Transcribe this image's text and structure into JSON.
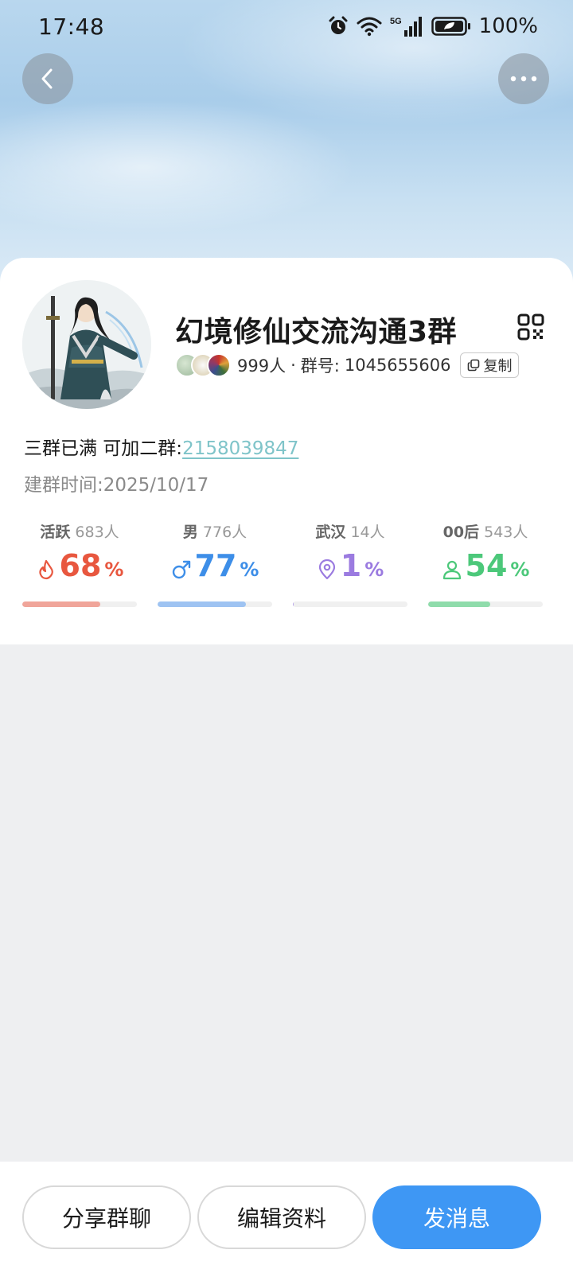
{
  "status_bar": {
    "time": "17:48",
    "network": "5G",
    "battery": "100%"
  },
  "header": {
    "back_icon": "chevron-left-icon",
    "more_icon": "more-horizontal-icon"
  },
  "group": {
    "name": "幻境修仙交流沟通3群",
    "member_count": "999人",
    "separator": "·",
    "id_label": "群号:",
    "id_value": "1045655606",
    "copy_label": "复制",
    "description_prefix": "三群已满 可加二群:",
    "description_link": "2158039847",
    "created_label": "建群时间:",
    "created_date": "2025/10/17"
  },
  "stats": [
    {
      "label": "活跃",
      "count": "683人",
      "value": "68",
      "unit": "%",
      "fraction": 0.68,
      "icon": "flame-icon",
      "color": "#e8573f",
      "bar_color": "#f0a59a"
    },
    {
      "label": "男",
      "count": "776人",
      "value": "77",
      "unit": "%",
      "fraction": 0.77,
      "icon": "male-icon",
      "color": "#3d8ee8",
      "bar_color": "#9ec3f2"
    },
    {
      "label": "武汉",
      "count": "14人",
      "value": "1",
      "unit": "%",
      "fraction": 0.01,
      "icon": "location-pin-icon",
      "color": "#9b7be0",
      "bar_color": "#b9a6ea"
    },
    {
      "label": "00后",
      "count": "543人",
      "value": "54",
      "unit": "%",
      "fraction": 0.54,
      "icon": "person-icon",
      "color": "#4cc87a",
      "bar_color": "#8fdcab"
    }
  ],
  "actions": {
    "share": "分享群聊",
    "edit": "编辑资料",
    "send": "发消息"
  }
}
